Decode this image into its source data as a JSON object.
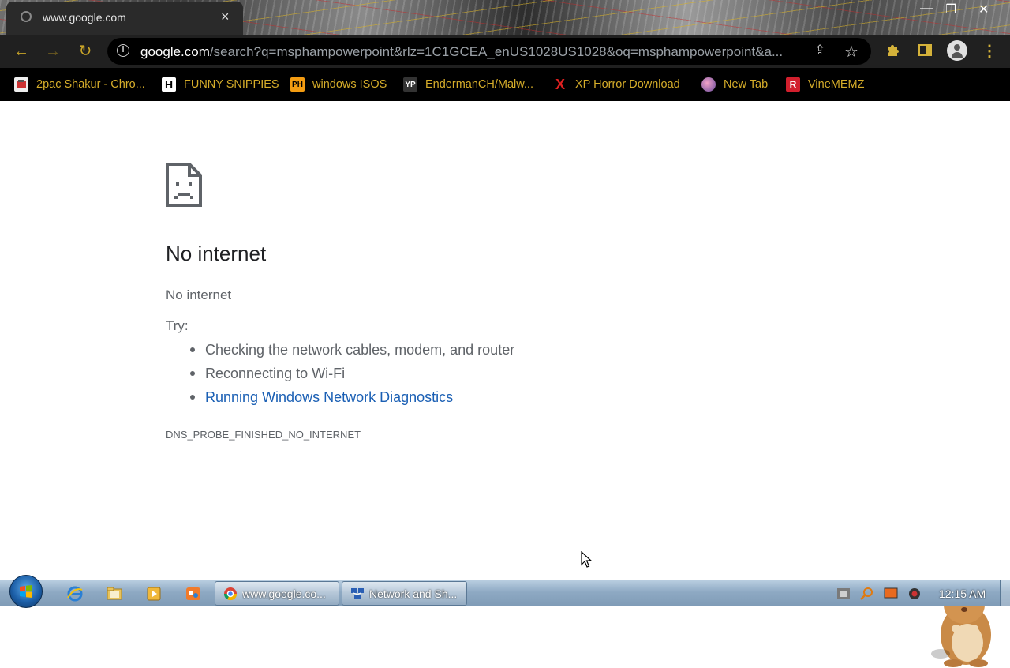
{
  "window": {
    "tab_title": "www.google.com",
    "tab_close": "×",
    "minimize": "—",
    "maximize": "❐",
    "close": "✕"
  },
  "toolbar": {
    "back_icon": "←",
    "forward_icon": "→",
    "reload_icon": "↻",
    "url_host": "google.com",
    "url_path": "/search?q=msphampowerpoint&rlz=1C1GCEA_enUS1028US1028&oq=msphampowerpoint&a...",
    "info_icon": "i",
    "share_icon": "⇪",
    "star_icon": "☆",
    "menu_icon": "⋮"
  },
  "bookmarks": [
    {
      "label": "2pac Shakur - Chro...",
      "icon": "music-icon"
    },
    {
      "label": "FUNNY SNIPPIES",
      "icon": "H"
    },
    {
      "label": "windows ISOS",
      "icon": "PH"
    },
    {
      "label": "EndermanCH/Malw...",
      "icon": "YP"
    },
    {
      "label": "XP Horror Download",
      "icon": "X"
    },
    {
      "label": "New Tab",
      "icon": "globe-icon"
    },
    {
      "label": "VineMEMZ",
      "icon": "R"
    }
  ],
  "error": {
    "heading": "No internet",
    "subline": "No internet",
    "try_label": "Try:",
    "suggestions": [
      "Checking the network cables, modem, and router",
      "Reconnecting to Wi-Fi",
      "Running Windows Network Diagnostics"
    ],
    "code": "DNS_PROBE_FINISHED_NO_INTERNET"
  },
  "taskbar": {
    "tasks": [
      {
        "label": "www.google.co..."
      },
      {
        "label": "Network and Sh..."
      }
    ],
    "clock": "12:15 AM"
  },
  "colors": {
    "accent_gold": "#d6ad2a",
    "link_blue": "#1a5fb4",
    "toolbar_bg": "#202020"
  }
}
